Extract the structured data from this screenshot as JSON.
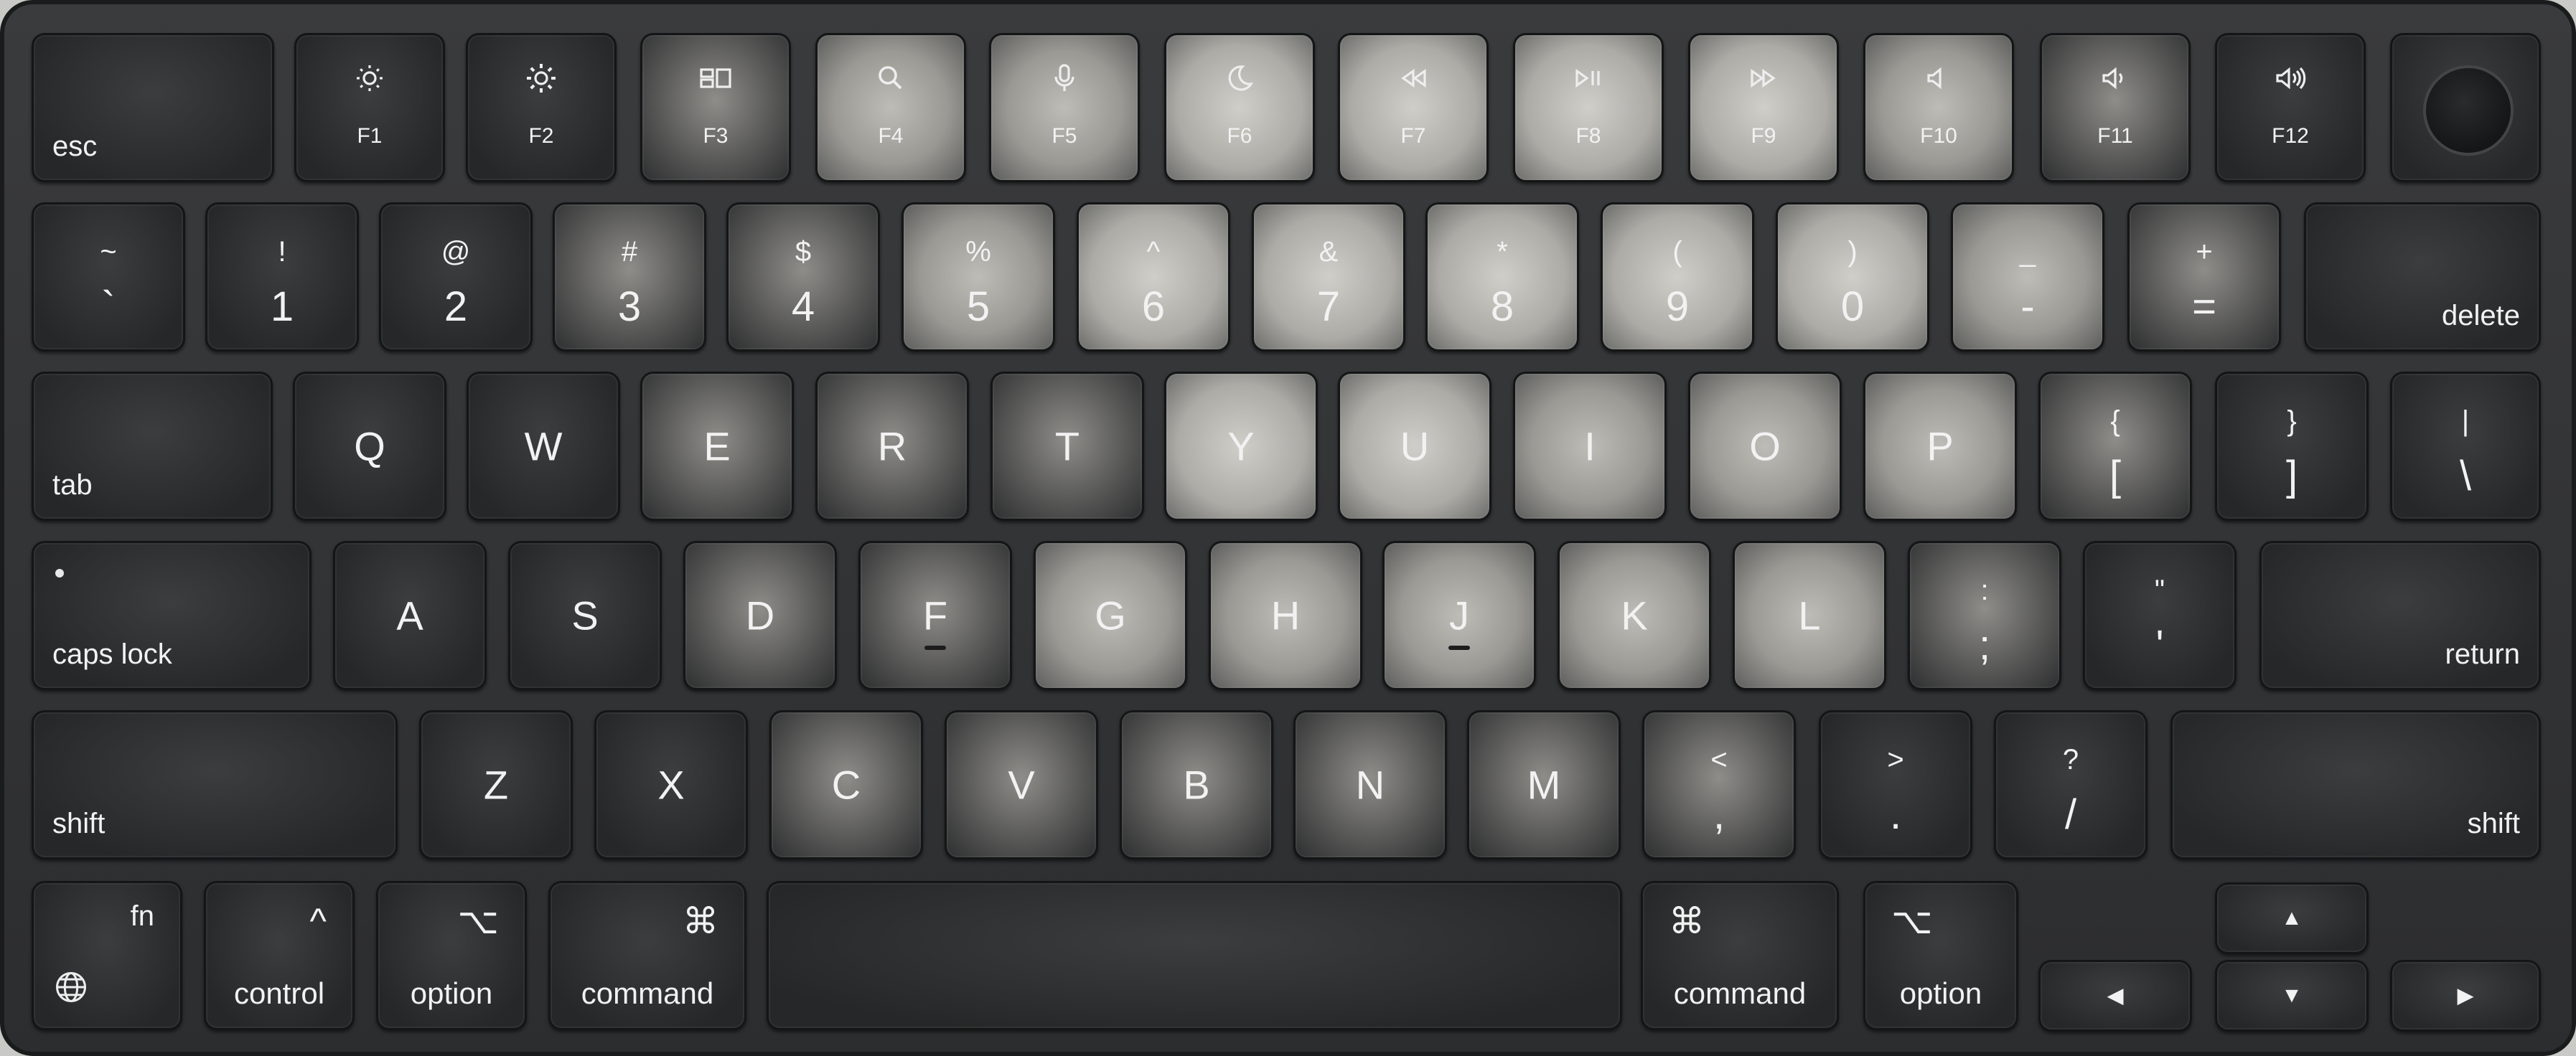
{
  "keyboard": {
    "function_row": {
      "esc": "esc",
      "f_keys": [
        {
          "label": "F1",
          "icon": "brightness-down-icon"
        },
        {
          "label": "F2",
          "icon": "brightness-up-icon"
        },
        {
          "label": "F3",
          "icon": "mission-control-icon"
        },
        {
          "label": "F4",
          "icon": "search-icon"
        },
        {
          "label": "F5",
          "icon": "microphone-icon"
        },
        {
          "label": "F6",
          "icon": "moon-icon"
        },
        {
          "label": "F7",
          "icon": "rewind-icon"
        },
        {
          "label": "F8",
          "icon": "play-pause-icon"
        },
        {
          "label": "F9",
          "icon": "fast-forward-icon"
        },
        {
          "label": "F10",
          "icon": "volume-mute-icon"
        },
        {
          "label": "F11",
          "icon": "volume-down-icon"
        },
        {
          "label": "F12",
          "icon": "volume-up-icon"
        }
      ],
      "touch_id_icon": "touch-id-icon"
    },
    "number_row": [
      {
        "shift": "~",
        "base": "`"
      },
      {
        "shift": "!",
        "base": "1"
      },
      {
        "shift": "@",
        "base": "2"
      },
      {
        "shift": "#",
        "base": "3"
      },
      {
        "shift": "$",
        "base": "4"
      },
      {
        "shift": "%",
        "base": "5"
      },
      {
        "shift": "^",
        "base": "6"
      },
      {
        "shift": "&",
        "base": "7"
      },
      {
        "shift": "*",
        "base": "8"
      },
      {
        "shift": "(",
        "base": "9"
      },
      {
        "shift": ")",
        "base": "0"
      },
      {
        "shift": "_",
        "base": "-"
      },
      {
        "shift": "+",
        "base": "="
      }
    ],
    "delete": "delete",
    "tab": "tab",
    "qwerty_row": [
      "Q",
      "W",
      "E",
      "R",
      "T",
      "Y",
      "U",
      "I",
      "O",
      "P"
    ],
    "bracket_keys": [
      {
        "shift": "{",
        "base": "["
      },
      {
        "shift": "}",
        "base": "]"
      },
      {
        "shift": "|",
        "base": "\\"
      }
    ],
    "caps_lock": "caps lock",
    "home_row": [
      "A",
      "S",
      "D",
      "F",
      "G",
      "H",
      "J",
      "K",
      "L"
    ],
    "home_symbols": [
      {
        "shift": ":",
        "base": ";"
      },
      {
        "shift": "\"",
        "base": "'"
      }
    ],
    "return": "return",
    "shift": "shift",
    "bottom_row": [
      "Z",
      "X",
      "C",
      "V",
      "B",
      "N",
      "M"
    ],
    "bottom_symbols": [
      {
        "shift": "<",
        "base": ","
      },
      {
        "shift": ">",
        "base": "."
      },
      {
        "shift": "?",
        "base": "/"
      }
    ],
    "modifiers": {
      "fn": "fn",
      "globe_icon": "globe-icon",
      "control": "control",
      "control_symbol": "^",
      "option": "option",
      "option_symbol": "⌥",
      "command": "command",
      "command_symbol": "⌘"
    },
    "arrows": {
      "up": "▲",
      "down": "▼",
      "left": "◀",
      "right": "▶"
    }
  }
}
